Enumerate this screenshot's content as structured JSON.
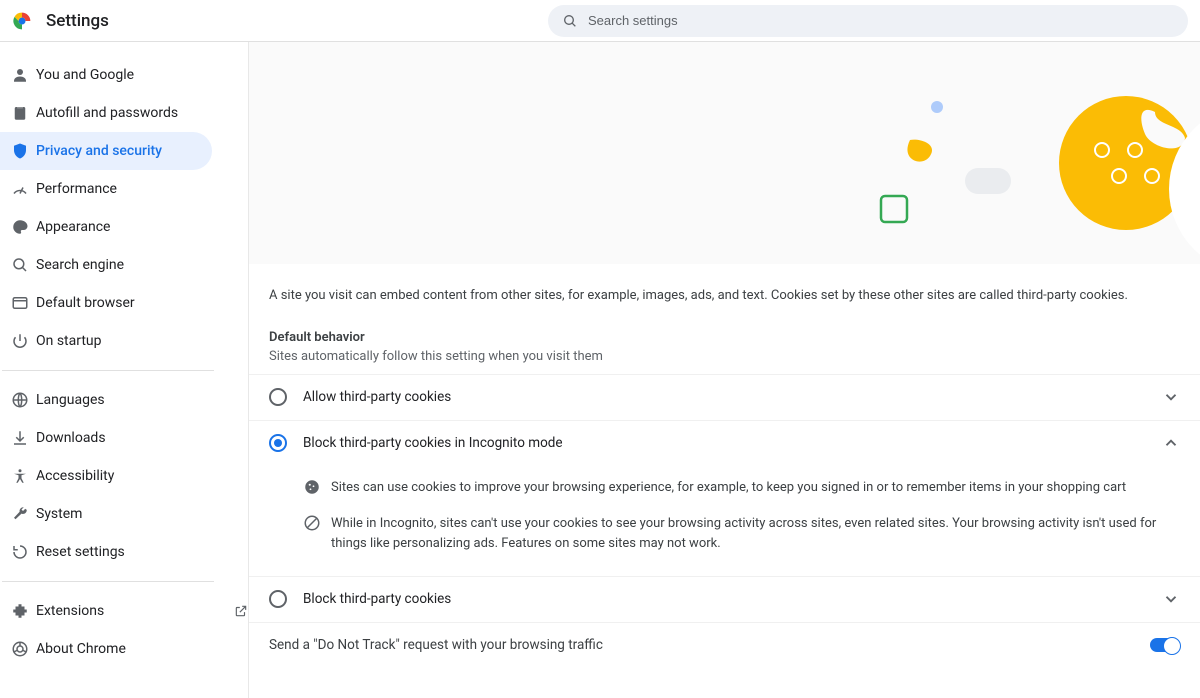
{
  "header": {
    "title": "Settings",
    "search_placeholder": "Search settings"
  },
  "sidebar": {
    "items": [
      {
        "label": "You and Google"
      },
      {
        "label": "Autofill and passwords"
      },
      {
        "label": "Privacy and security"
      },
      {
        "label": "Performance"
      },
      {
        "label": "Appearance"
      },
      {
        "label": "Search engine"
      },
      {
        "label": "Default browser"
      },
      {
        "label": "On startup"
      }
    ],
    "secondary": [
      {
        "label": "Languages"
      },
      {
        "label": "Downloads"
      },
      {
        "label": "Accessibility"
      },
      {
        "label": "System"
      },
      {
        "label": "Reset settings"
      }
    ],
    "tertiary": [
      {
        "label": "Extensions"
      },
      {
        "label": "About Chrome"
      }
    ]
  },
  "main": {
    "description": "A site you visit can embed content from other sites, for example, images, ads, and text. Cookies set by these other sites are called third-party cookies.",
    "section_title": "Default behavior",
    "section_sub": "Sites automatically follow this setting when you visit them",
    "options": [
      {
        "label": "Allow third-party cookies",
        "selected": false,
        "expanded": false
      },
      {
        "label": "Block third-party cookies in Incognito mode",
        "selected": true,
        "expanded": true
      },
      {
        "label": "Block third-party cookies",
        "selected": false,
        "expanded": false
      }
    ],
    "expanded_bullets": [
      "Sites can use cookies to improve your browsing experience, for example, to keep you signed in or to remember items in your shopping cart",
      "While in Incognito, sites can't use your cookies to see your browsing activity across sites, even related sites. Your browsing activity isn't used for things like personalizing ads. Features on some sites may not work."
    ],
    "dnt_label": "Send a \"Do Not Track\" request with your browsing traffic",
    "dnt_on": true
  }
}
